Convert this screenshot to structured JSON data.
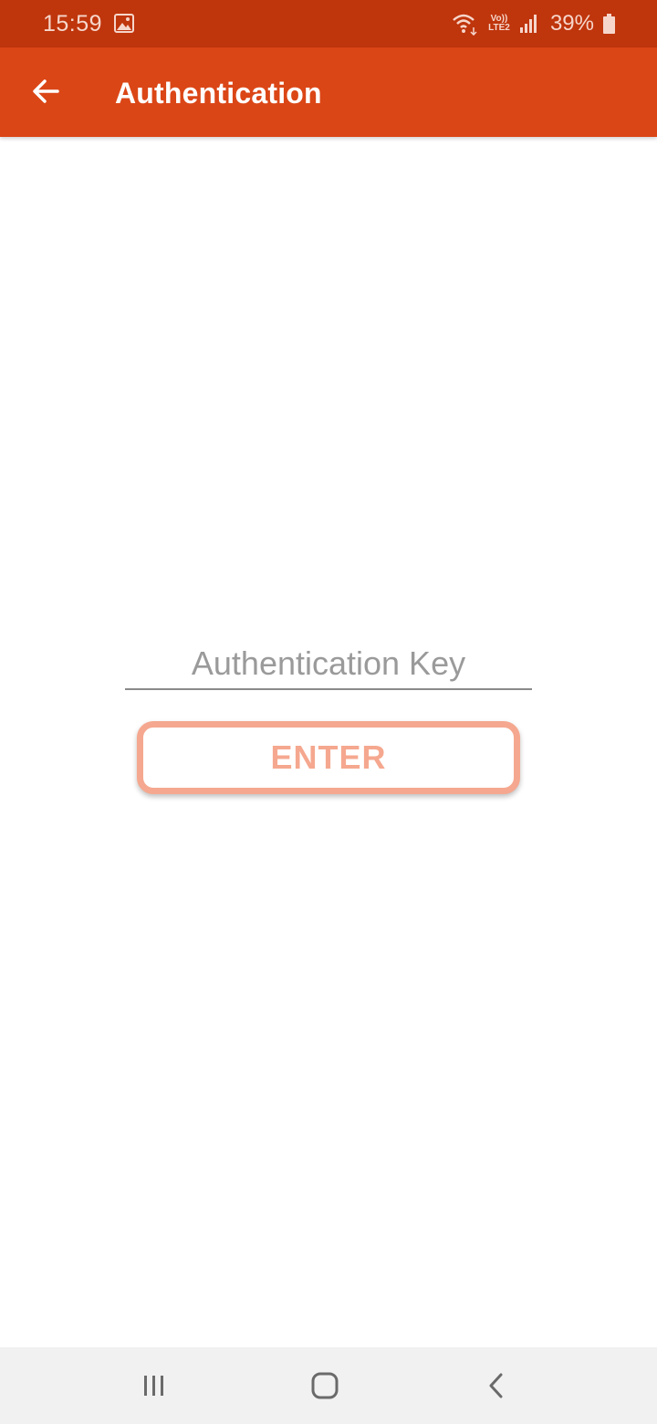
{
  "status_bar": {
    "time": "15:59",
    "volte_top": "Vo))",
    "volte_bottom": "LTE2",
    "battery_percent": "39%",
    "icons": [
      "gallery-icon",
      "wifi-icon",
      "volte-lte-icon",
      "signal-icon",
      "battery-icon"
    ]
  },
  "app_bar": {
    "title": "Authentication",
    "back_icon": "arrow-left-icon",
    "background": "#db4616"
  },
  "form": {
    "input_placeholder": "Authentication Key",
    "input_value": "",
    "button_label": "ENTER"
  },
  "nav_bar": {
    "icons": [
      "recents-icon",
      "home-icon",
      "back-icon"
    ]
  },
  "colors": {
    "status_bar": "#bf350c",
    "app_bar": "#db4616",
    "button_accent": "#f5a88f"
  }
}
